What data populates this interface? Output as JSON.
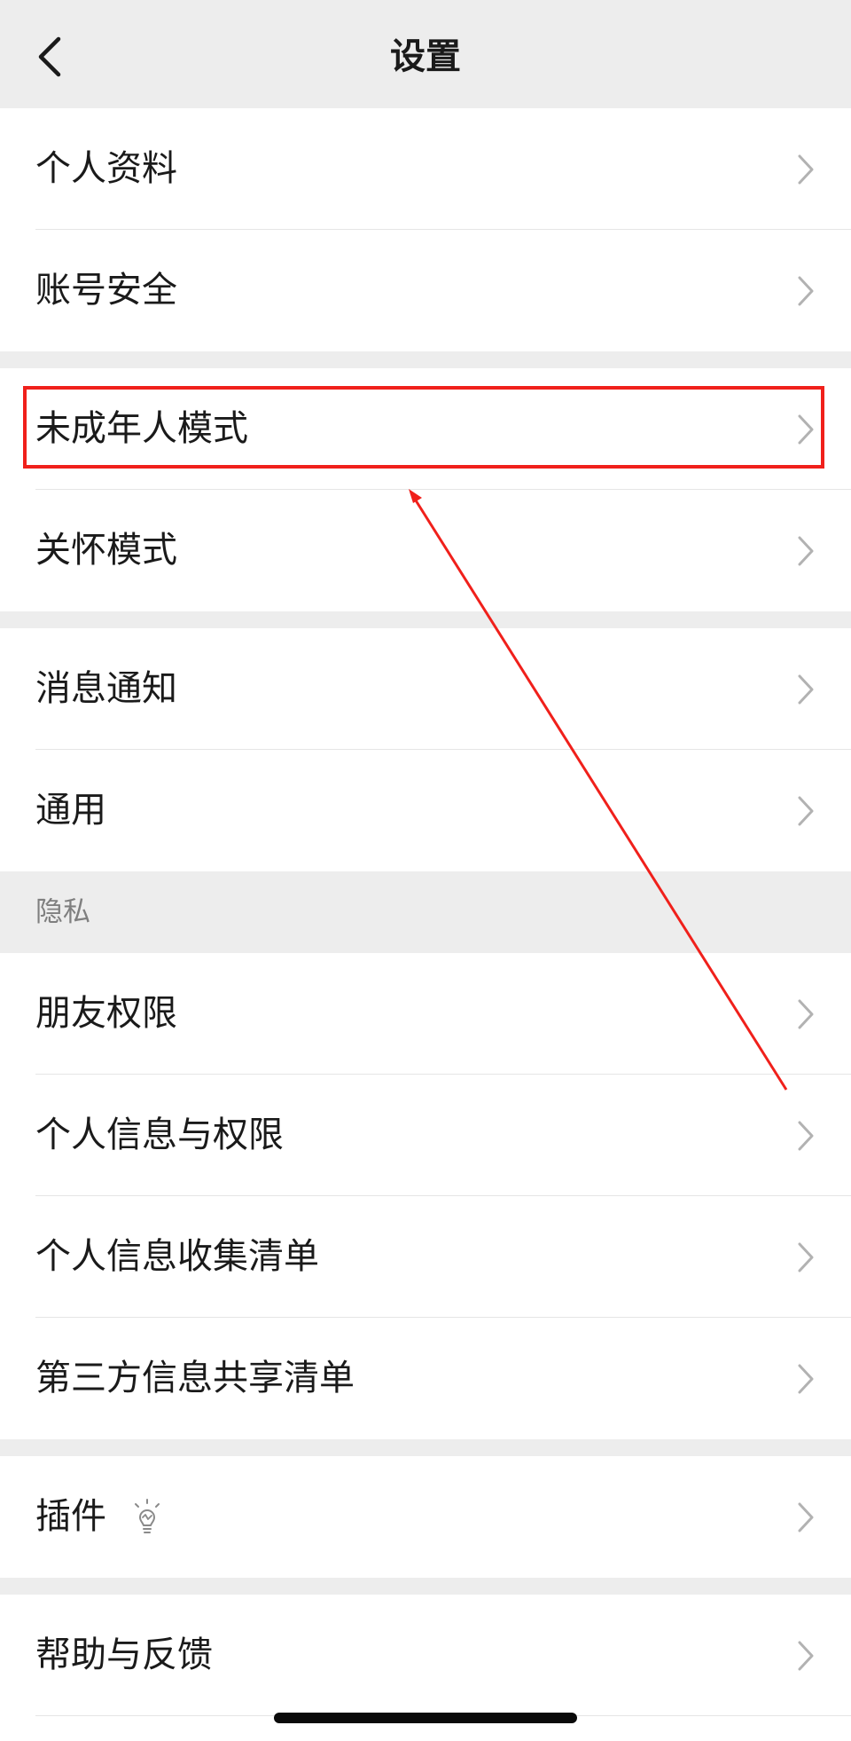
{
  "nav": {
    "title": "设置",
    "back_icon": "chevron-left-icon"
  },
  "groups": [
    {
      "items": [
        {
          "label": "个人资料"
        },
        {
          "label": "账号安全"
        }
      ]
    },
    {
      "items": [
        {
          "label": "未成年人模式"
        },
        {
          "label": "关怀模式"
        }
      ]
    },
    {
      "items": [
        {
          "label": "消息通知"
        },
        {
          "label": "通用"
        }
      ]
    },
    {
      "header": "隐私",
      "items": [
        {
          "label": "朋友权限"
        },
        {
          "label": "个人信息与权限"
        },
        {
          "label": "个人信息收集清单"
        },
        {
          "label": "第三方信息共享清单"
        }
      ]
    },
    {
      "items": [
        {
          "label": "插件",
          "icon": "lightbulb-icon"
        }
      ]
    },
    {
      "items": [
        {
          "label": "帮助与反馈"
        }
      ]
    }
  ],
  "annotation": {
    "highlight_color": "#f0201b",
    "highlighted_item": "未成年人模式"
  },
  "colors": {
    "background": "#ededed",
    "row_bg": "#ffffff",
    "text": "#1a1a1a",
    "chevron": "#b2b2b2",
    "section_header": "#7f7f7f"
  }
}
